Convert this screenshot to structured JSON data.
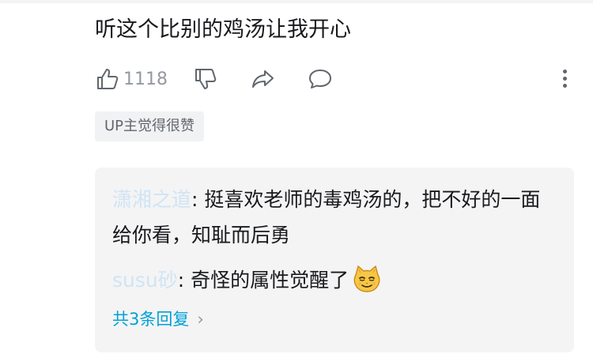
{
  "comment": {
    "text": "听这个比别的鸡汤让我开心",
    "likes": "1118",
    "badge": "UP主觉得很赞"
  },
  "icons": {
    "like": "thumbs-up-icon",
    "dislike": "thumbs-down-icon",
    "share": "share-icon",
    "reply": "comment-icon",
    "more": "more-vertical-icon"
  },
  "replies": [
    {
      "username": "潇湘之道",
      "separator": ": ",
      "text": "挺喜欢老师的毒鸡汤的，把不好的一面给你看，知耻而后勇"
    },
    {
      "username": "susu砂",
      "separator": ": ",
      "text": "奇怪的属性觉醒了",
      "sticker": "smug-cat-emoji"
    }
  ],
  "view_all": "共3条回复",
  "view_all_chevron": "›",
  "colors": {
    "link": "#00a1d6",
    "muted": "#9499a0",
    "reply_bg": "#f4f4f5"
  }
}
